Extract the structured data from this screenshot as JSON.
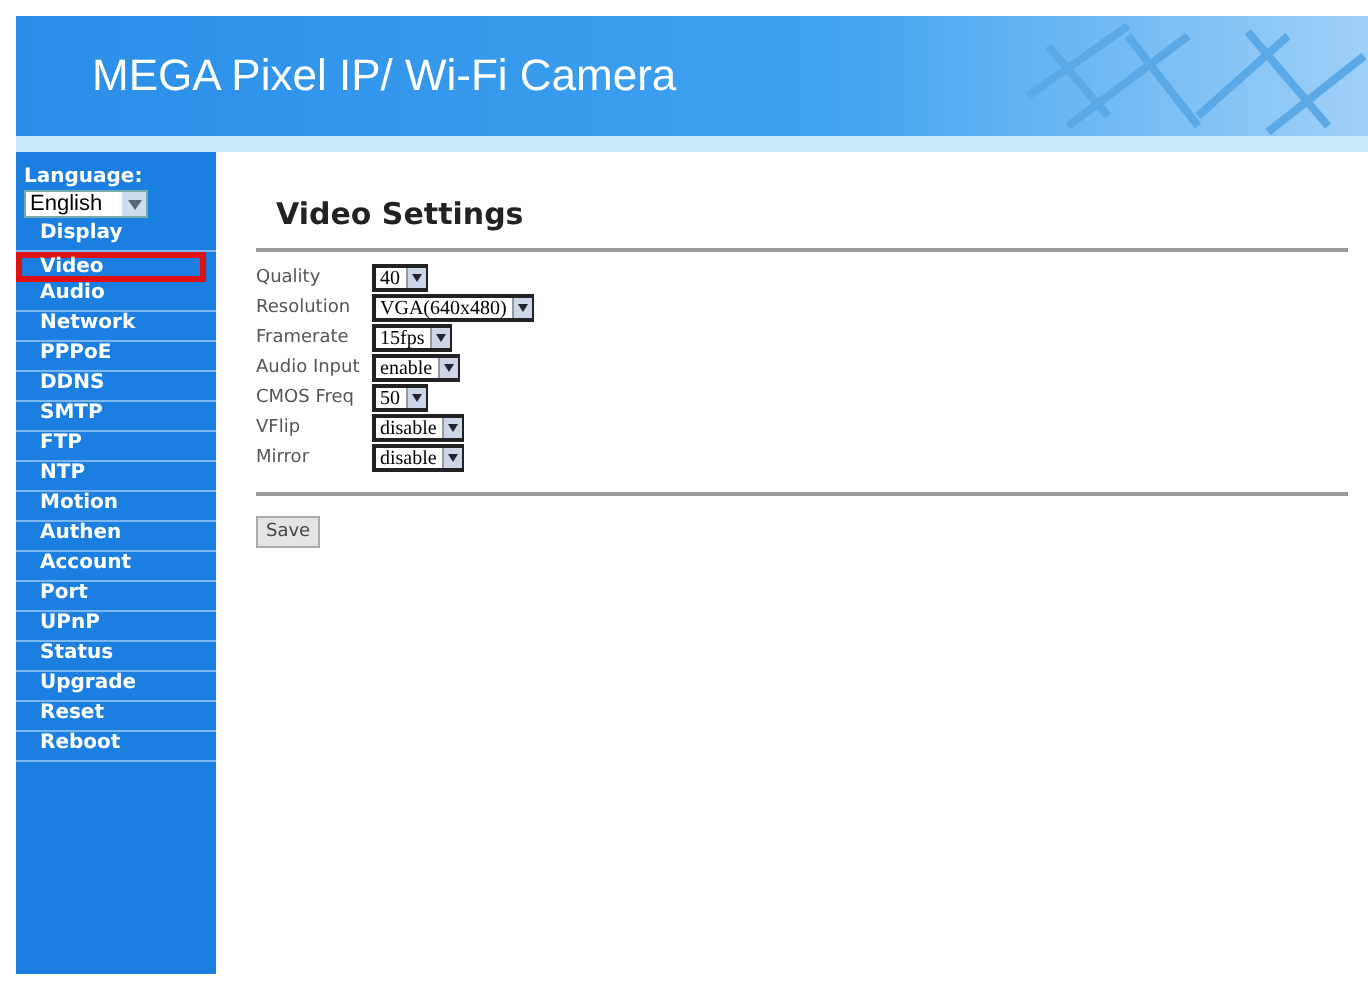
{
  "header": {
    "title": "MEGA Pixel IP/ Wi-Fi Camera"
  },
  "sidebar": {
    "language_label": "Language:",
    "language": "English",
    "items": [
      {
        "label": "Display",
        "selected": false
      },
      {
        "label": "Video",
        "selected": true
      },
      {
        "label": "Audio",
        "selected": false
      },
      {
        "label": "Network",
        "selected": false
      },
      {
        "label": "PPPoE",
        "selected": false
      },
      {
        "label": "DDNS",
        "selected": false
      },
      {
        "label": "SMTP",
        "selected": false
      },
      {
        "label": "FTP",
        "selected": false
      },
      {
        "label": "NTP",
        "selected": false
      },
      {
        "label": "Motion",
        "selected": false
      },
      {
        "label": "Authen",
        "selected": false
      },
      {
        "label": "Account",
        "selected": false
      },
      {
        "label": "Port",
        "selected": false
      },
      {
        "label": "UPnP",
        "selected": false
      },
      {
        "label": "Status",
        "selected": false
      },
      {
        "label": "Upgrade",
        "selected": false
      },
      {
        "label": "Reset",
        "selected": false
      },
      {
        "label": "Reboot",
        "selected": false
      }
    ]
  },
  "content": {
    "heading": "Video Settings",
    "fields": [
      {
        "label": "Quality",
        "value": "40"
      },
      {
        "label": "Resolution",
        "value": "VGA(640x480)"
      },
      {
        "label": "Framerate",
        "value": "15fps"
      },
      {
        "label": "Audio Input",
        "value": "enable"
      },
      {
        "label": "CMOS Freq",
        "value": "50"
      },
      {
        "label": "VFlip",
        "value": "disable"
      },
      {
        "label": "Mirror",
        "value": "disable"
      }
    ],
    "save_button": "Save"
  }
}
